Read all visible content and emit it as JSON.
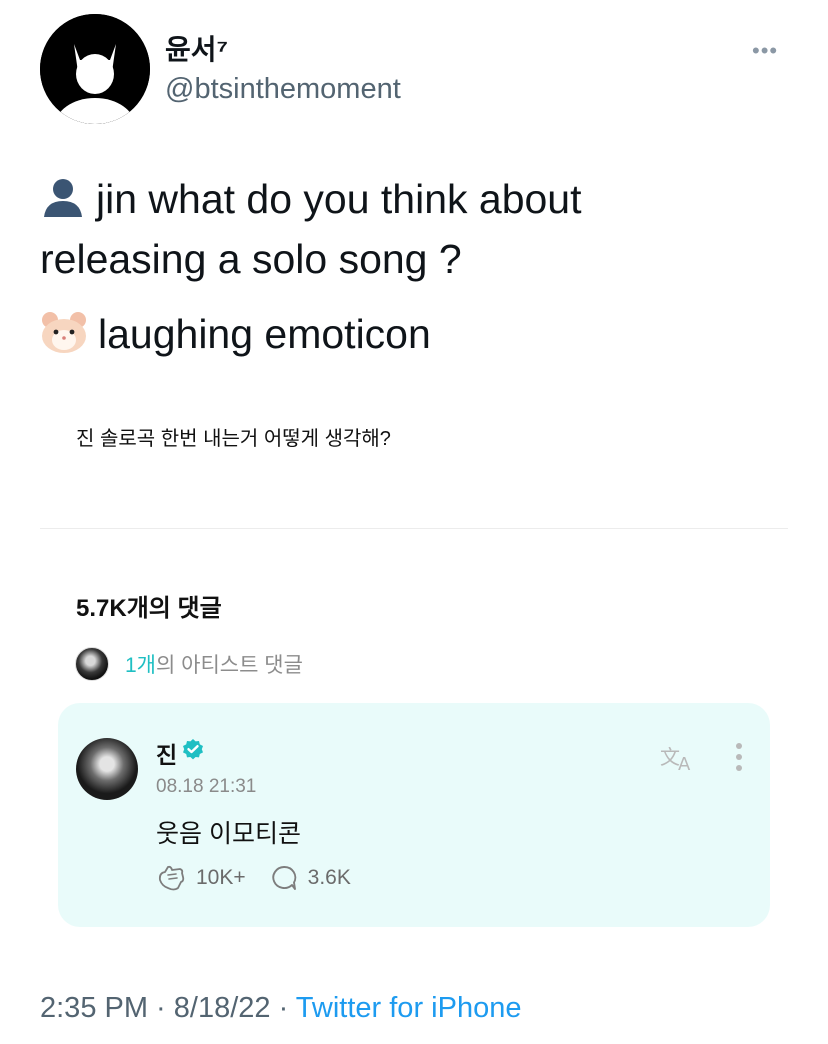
{
  "author": {
    "display_name": "윤서⁷",
    "handle": "@btsinthemoment"
  },
  "more_icon": "more-dots-icon",
  "tweet": {
    "line1_emoji": "bust-in-silhouette-emoji",
    "line1": "jin what do you think about",
    "line2": "releasing a solo song ?",
    "line3_emoji": "hamster-emoji",
    "line3": "laughing emoticon"
  },
  "screenshot": {
    "question": "진 솔로곡 한번 내는거 어떻게 생각해?",
    "comment_count": "5.7K개의 댓글",
    "artist_count": "1개",
    "artist_label": "의 아티스트 댓글",
    "reply": {
      "name": "진",
      "time": "08.18 21:31",
      "text": "웃음 이모티콘",
      "likes": "10K+",
      "comments": "3.6K"
    },
    "accent_color": "#1fbfc3",
    "reply_bg": "#e9fbfa"
  },
  "footer": {
    "time": "2:35 PM",
    "sep1": " · ",
    "date": "8/18/22",
    "sep2": " · ",
    "source": "Twitter for iPhone"
  },
  "colors": {
    "link": "#1d9bf0",
    "secondary_text": "#536471"
  }
}
